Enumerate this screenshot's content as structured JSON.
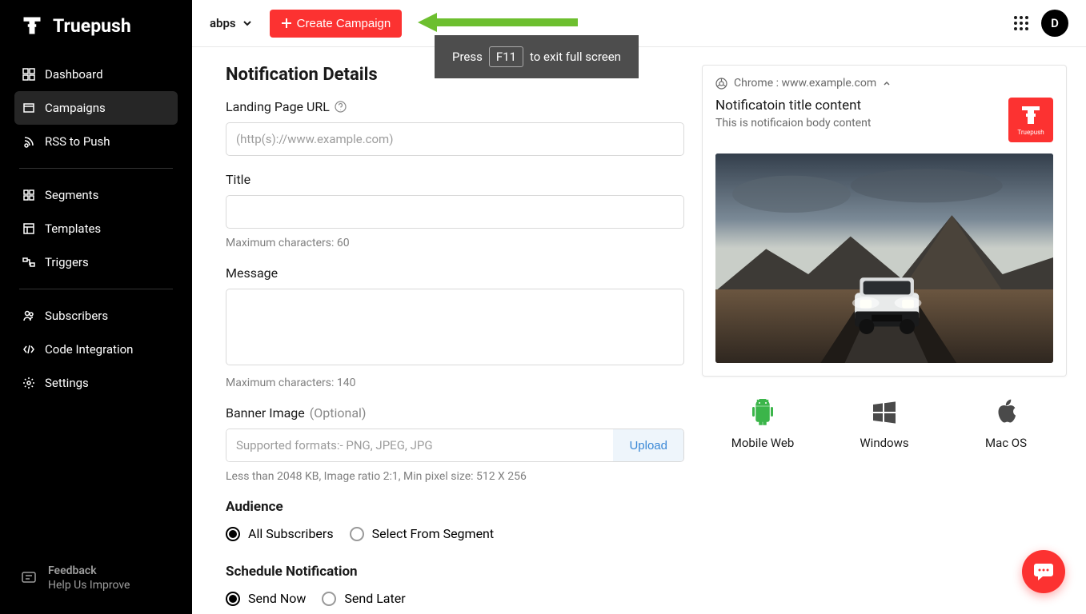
{
  "brand": {
    "name": "Truepush"
  },
  "sidebar": {
    "items": [
      {
        "label": "Dashboard"
      },
      {
        "label": "Campaigns"
      },
      {
        "label": "RSS to Push"
      },
      {
        "label": "Segments"
      },
      {
        "label": "Templates"
      },
      {
        "label": "Triggers"
      },
      {
        "label": "Subscribers"
      },
      {
        "label": "Code Integration"
      },
      {
        "label": "Settings"
      }
    ],
    "feedback": {
      "title": "Feedback",
      "subtitle": "Help Us Improve"
    }
  },
  "topbar": {
    "site": "abps",
    "create_label": "Create Campaign",
    "avatar_letter": "D"
  },
  "toast": {
    "pre": "Press",
    "key": "F11",
    "post": "to exit full screen"
  },
  "form": {
    "section_title": "Notification Details",
    "url_label": "Landing Page URL",
    "url_placeholder": "(http(s)://www.example.com)",
    "title_label": "Title",
    "title_hint": "Maximum characters: 60",
    "message_label": "Message",
    "message_hint": "Maximum characters: 140",
    "banner_label": "Banner Image",
    "banner_optional": "(Optional)",
    "banner_placeholder": "Supported formats:- PNG, JPEG, JPG",
    "banner_upload": "Upload",
    "banner_hint": "Less than 2048 KB, Image ratio 2:1, Min pixel size: 512 X 256",
    "audience_title": "Audience",
    "audience_all": "All Subscribers",
    "audience_segment": "Select From Segment",
    "schedule_title": "Schedule Notification",
    "schedule_now": "Send Now",
    "schedule_later": "Send Later"
  },
  "preview": {
    "browser": "Chrome : www.example.com",
    "title": "Notificatoin title content",
    "body": "This is notificaion body content",
    "badge_label": "Truepush",
    "devices": [
      {
        "label": "Mobile Web"
      },
      {
        "label": "Windows"
      },
      {
        "label": "Mac OS"
      }
    ]
  }
}
